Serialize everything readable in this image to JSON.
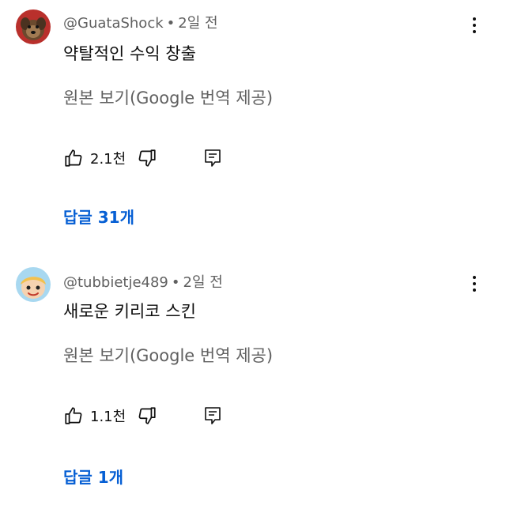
{
  "comments": [
    {
      "author": "@GuataShock",
      "separator": "•",
      "time": "2일 전",
      "text": "약탈적인 수익 창출",
      "translate": "원본 보기(Google 번역 제공)",
      "likes": "2.1천",
      "replies": "답글 31개"
    },
    {
      "author": "@tubbietje489",
      "separator": "•",
      "time": "2일 전",
      "text": "새로운 키리코 스킨",
      "translate": "원본 보기(Google 번역 제공)",
      "likes": "1.1천",
      "replies": "답글 1개"
    }
  ],
  "colors": {
    "reply_link": "#065fd4",
    "secondary_text": "#606060",
    "primary_text": "#0f0f0f"
  },
  "icons": [
    "avatar-dog",
    "avatar-cartoon",
    "more-vert-icon",
    "thumb-up-icon",
    "thumb-down-icon",
    "reply-icon"
  ]
}
